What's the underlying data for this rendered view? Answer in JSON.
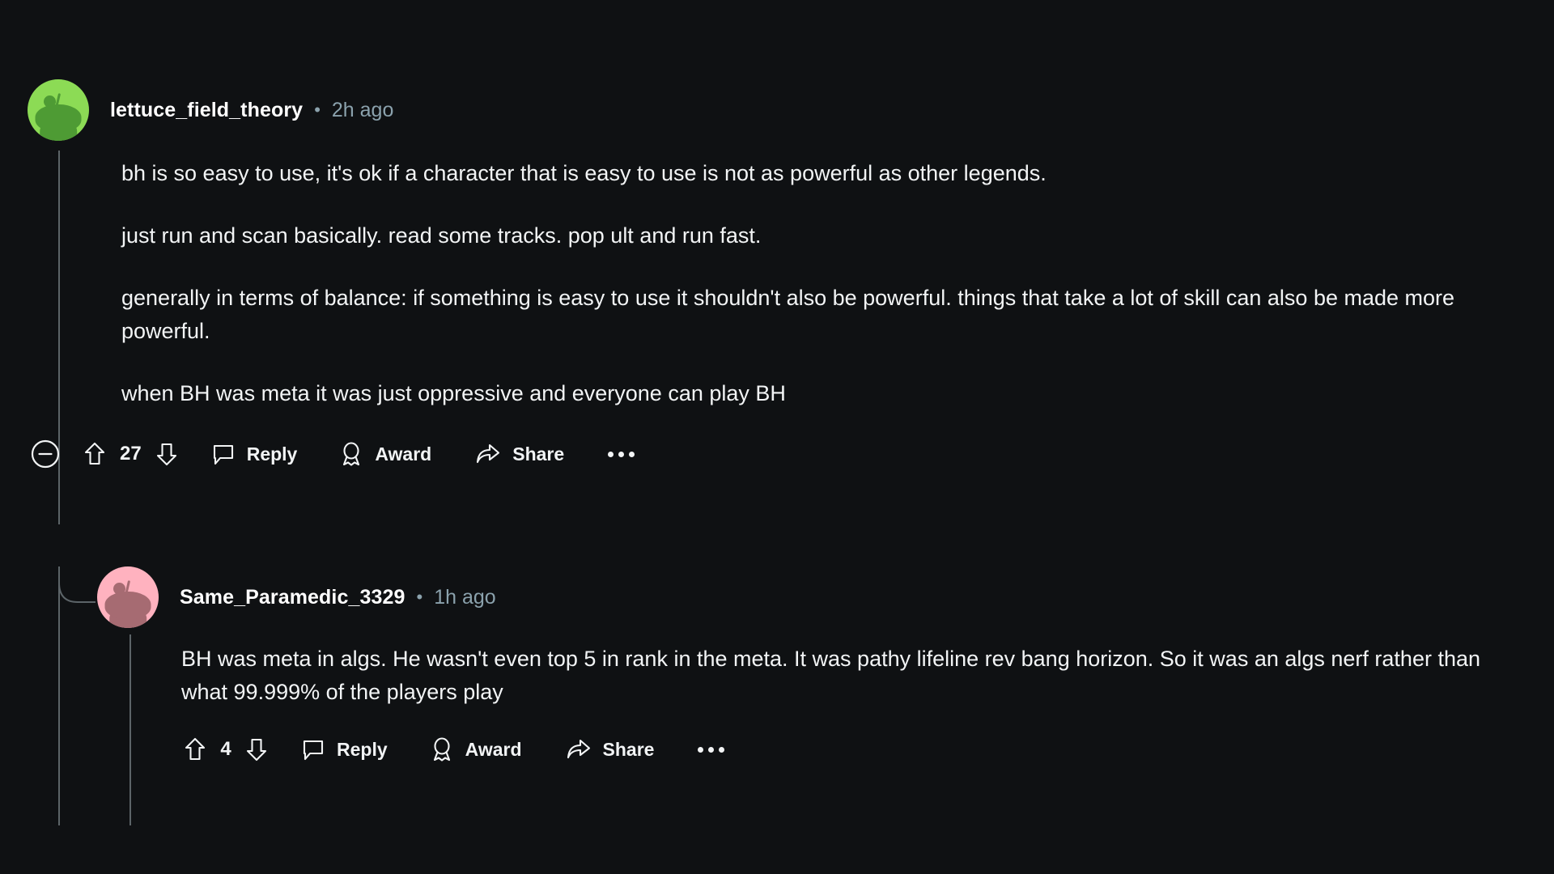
{
  "theme": {
    "background": "#0f1113",
    "text_primary": "#f2f4f5",
    "text_muted": "#8ba2ad",
    "thread_line": "#5c6468",
    "avatar_green": "#8cdb55",
    "avatar_green_snoo": "#4e9b34",
    "avatar_pink": "#ffb2bf",
    "avatar_pink_snoo": "#a66b72"
  },
  "comments": [
    {
      "author": "lettuce_field_theory",
      "separator": "•",
      "timestamp": "2h ago",
      "avatar_icon": "reddit-snoo-avatar-green",
      "paragraphs": [
        "bh is so easy to use, it's ok if a character that is easy to use is not as powerful as other legends.",
        "just run and scan basically. read some tracks. pop ult and run fast.",
        "generally in terms of balance: if something is easy to use it shouldn't also be powerful. things that take a lot of skill can also be made more powerful.",
        "when BH was meta it was just oppressive and everyone can play BH"
      ],
      "actions": {
        "collapse_label": "collapse-thread",
        "score": "27",
        "upvote_label": "upvote",
        "downvote_label": "downvote",
        "reply_label": "Reply",
        "award_label": "Award",
        "share_label": "Share",
        "more_label": "more options"
      }
    },
    {
      "author": "Same_Paramedic_3329",
      "separator": "•",
      "timestamp": "1h ago",
      "avatar_icon": "reddit-snoo-avatar-pink",
      "paragraphs": [
        "BH was meta in algs. He wasn't even top 5 in rank in the meta. It was pathy lifeline rev bang horizon. So it was an algs nerf rather than what 99.999% of the players play"
      ],
      "actions": {
        "score": "4",
        "upvote_label": "upvote",
        "downvote_label": "downvote",
        "reply_label": "Reply",
        "award_label": "Award",
        "share_label": "Share",
        "more_label": "more options"
      }
    }
  ]
}
